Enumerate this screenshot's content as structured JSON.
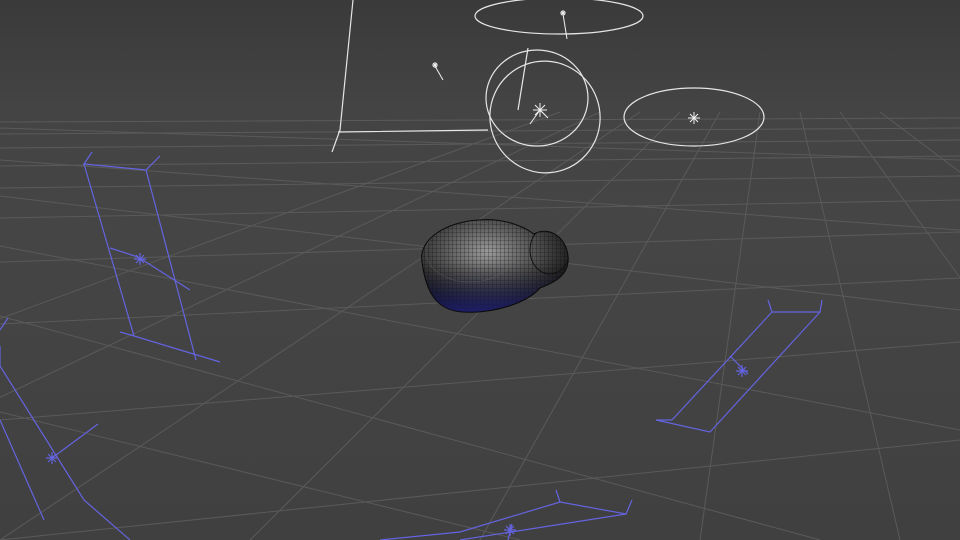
{
  "viewport": {
    "background_top": "#3a3a3a",
    "background_bottom": "#404040",
    "grid_color": "#585858",
    "curve_color": "#e6e6e6",
    "selection_color": "#6a6af0",
    "mesh_color": "#1f1f1f"
  },
  "scene": {
    "grid": "perspective-ground-grid",
    "mesh_object": "wireframe-blob-mesh",
    "light_locators": [
      "point-light-1",
      "point-light-2",
      "point-light-3",
      "point-light-4"
    ],
    "nurbs_circles": [
      "nurbs-circle-1",
      "nurbs-circle-2",
      "nurbs-circle-3",
      "nurbs-circle-4"
    ],
    "camera_frames": [
      "area-light-frame-1",
      "area-light-frame-2",
      "area-light-frame-3",
      "area-light-frame-4"
    ]
  }
}
